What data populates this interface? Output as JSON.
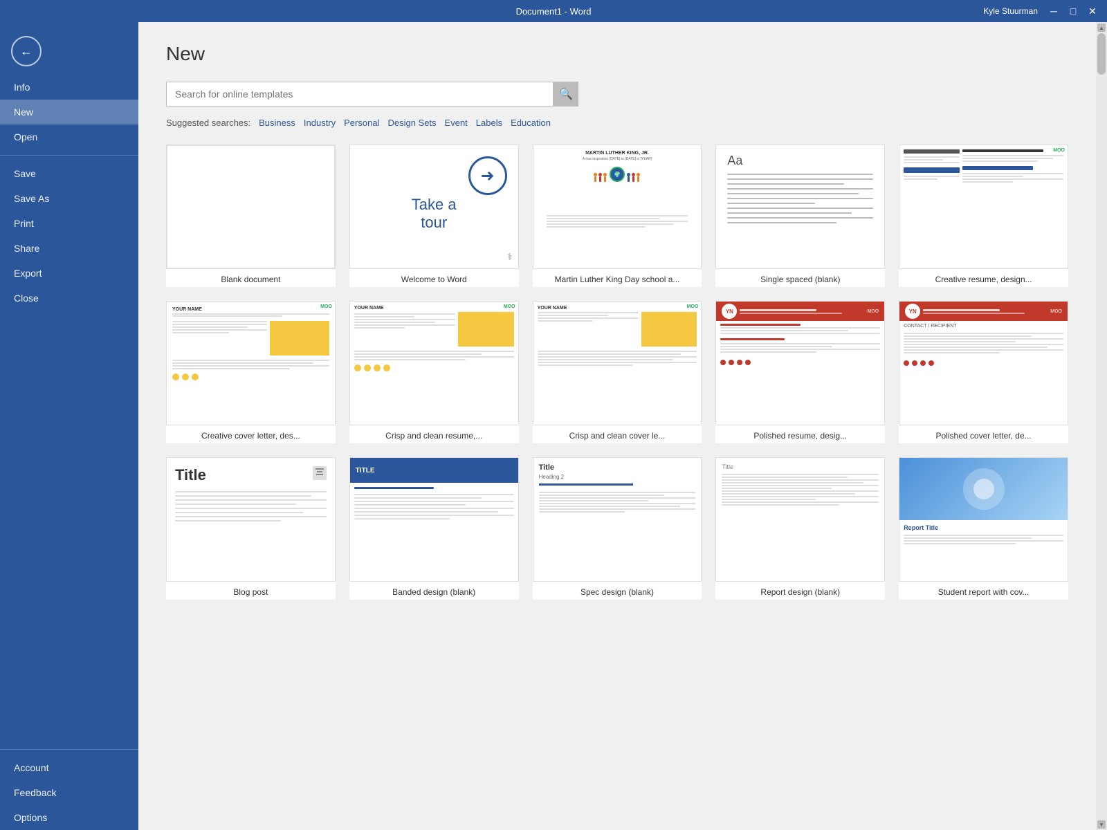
{
  "titleBar": {
    "title": "Document1 - Word",
    "user": "Kyle Stuurman",
    "minBtn": "─",
    "maxBtn": "□",
    "closeBtn": "✕"
  },
  "sidebar": {
    "backLabel": "←",
    "items": [
      {
        "id": "info",
        "label": "Info"
      },
      {
        "id": "new",
        "label": "New",
        "active": true
      },
      {
        "id": "open",
        "label": "Open"
      },
      {
        "id": "save",
        "label": "Save"
      },
      {
        "id": "save-as",
        "label": "Save As"
      },
      {
        "id": "print",
        "label": "Print"
      },
      {
        "id": "share",
        "label": "Share"
      },
      {
        "id": "export",
        "label": "Export"
      },
      {
        "id": "close",
        "label": "Close"
      },
      {
        "id": "account",
        "label": "Account"
      },
      {
        "id": "feedback",
        "label": "Feedback"
      },
      {
        "id": "options",
        "label": "Options"
      }
    ]
  },
  "main": {
    "pageTitle": "New",
    "search": {
      "placeholder": "Search for online templates",
      "btnLabel": "🔍"
    },
    "suggestedSearches": {
      "label": "Suggested searches:",
      "links": [
        "Business",
        "Industry",
        "Personal",
        "Design Sets",
        "Event",
        "Labels",
        "Education"
      ]
    },
    "templates": [
      {
        "id": "blank",
        "label": "Blank document",
        "type": "blank"
      },
      {
        "id": "tour",
        "label": "Welcome to Word",
        "type": "tour"
      },
      {
        "id": "mlk",
        "label": "Martin Luther King Day school a...",
        "type": "mlk"
      },
      {
        "id": "single-spaced",
        "label": "Single spaced (blank)",
        "type": "single-spaced"
      },
      {
        "id": "creative-resume",
        "label": "Creative resume, design...",
        "type": "creative-resume"
      },
      {
        "id": "creative-cover",
        "label": "Creative cover letter, des...",
        "type": "creative-cover"
      },
      {
        "id": "crisp-resume",
        "label": "Crisp and clean resume,...",
        "type": "crisp-resume"
      },
      {
        "id": "crisp-cover",
        "label": "Crisp and clean cover le...",
        "type": "crisp-cover"
      },
      {
        "id": "polished-resume",
        "label": "Polished resume, desig...",
        "type": "polished-resume"
      },
      {
        "id": "polished-cover",
        "label": "Polished cover letter, de...",
        "type": "polished-cover"
      },
      {
        "id": "blog-post",
        "label": "Blog post",
        "type": "blog-post"
      },
      {
        "id": "banded",
        "label": "Banded design (blank)",
        "type": "banded"
      },
      {
        "id": "spec",
        "label": "Spec design (blank)",
        "type": "spec"
      },
      {
        "id": "report",
        "label": "Report design (blank)",
        "type": "report"
      },
      {
        "id": "student-report",
        "label": "Student report with cov...",
        "type": "student-report"
      }
    ]
  }
}
